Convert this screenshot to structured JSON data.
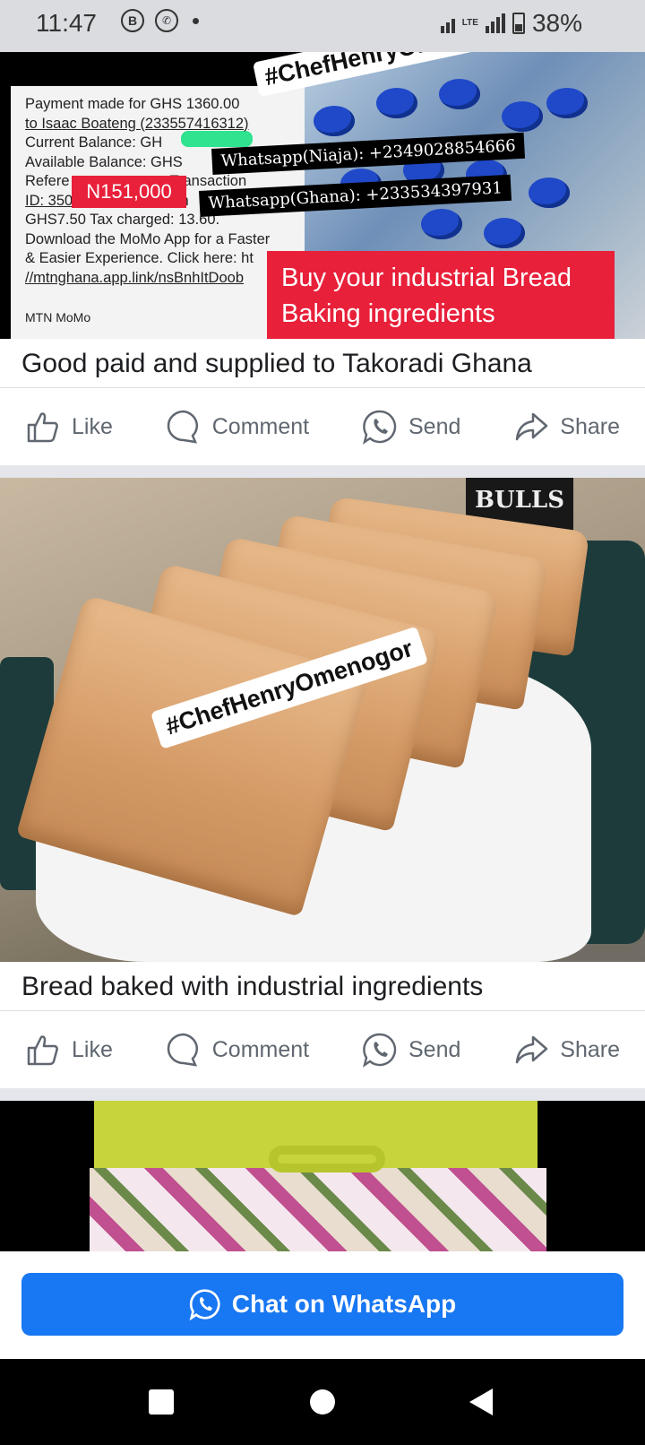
{
  "status": {
    "time": "11:47",
    "battery": "38%",
    "network": "LTE"
  },
  "post1": {
    "receipt_lines": [
      "Payment made for GHS 1360.00",
      "to Isaac Boateng (233557416312)",
      "Current Balance: GH",
      "Available Balance: GHS",
      "Refere",
      "ID: 350",
      "GHS7.50 Tax charged: 13.60.",
      "Download the MoMo App for a Faster",
      "& Easier Experience. Click here: ht",
      "//mtnghana.app.link/nsBnhItDoob"
    ],
    "receipt_frag": "Transaction",
    "receipt_ch": "ch",
    "mtn_label": "MTN MoMo",
    "hashtag": "#ChefHenryOmen",
    "whatsapp_nigeria": "Whatsapp(Niaja): +2349028854666",
    "whatsapp_ghana": "Whatsapp(Ghana): +233534397931",
    "amount": "N151,000",
    "buy_text": "Buy your industrial Bread Baking ingredients",
    "caption": "Good paid and supplied to Takoradi Ghana"
  },
  "post2": {
    "hashtag": "#ChefHenryOmenogor",
    "bulls": "BULLS",
    "caption": "Bread baked with industrial ingredients"
  },
  "actions": {
    "like": "Like",
    "comment": "Comment",
    "send": "Send",
    "share": "Share"
  },
  "cta": {
    "label": "Chat on WhatsApp"
  },
  "colors": {
    "accent": "#1877f2",
    "red": "#e8203a"
  }
}
